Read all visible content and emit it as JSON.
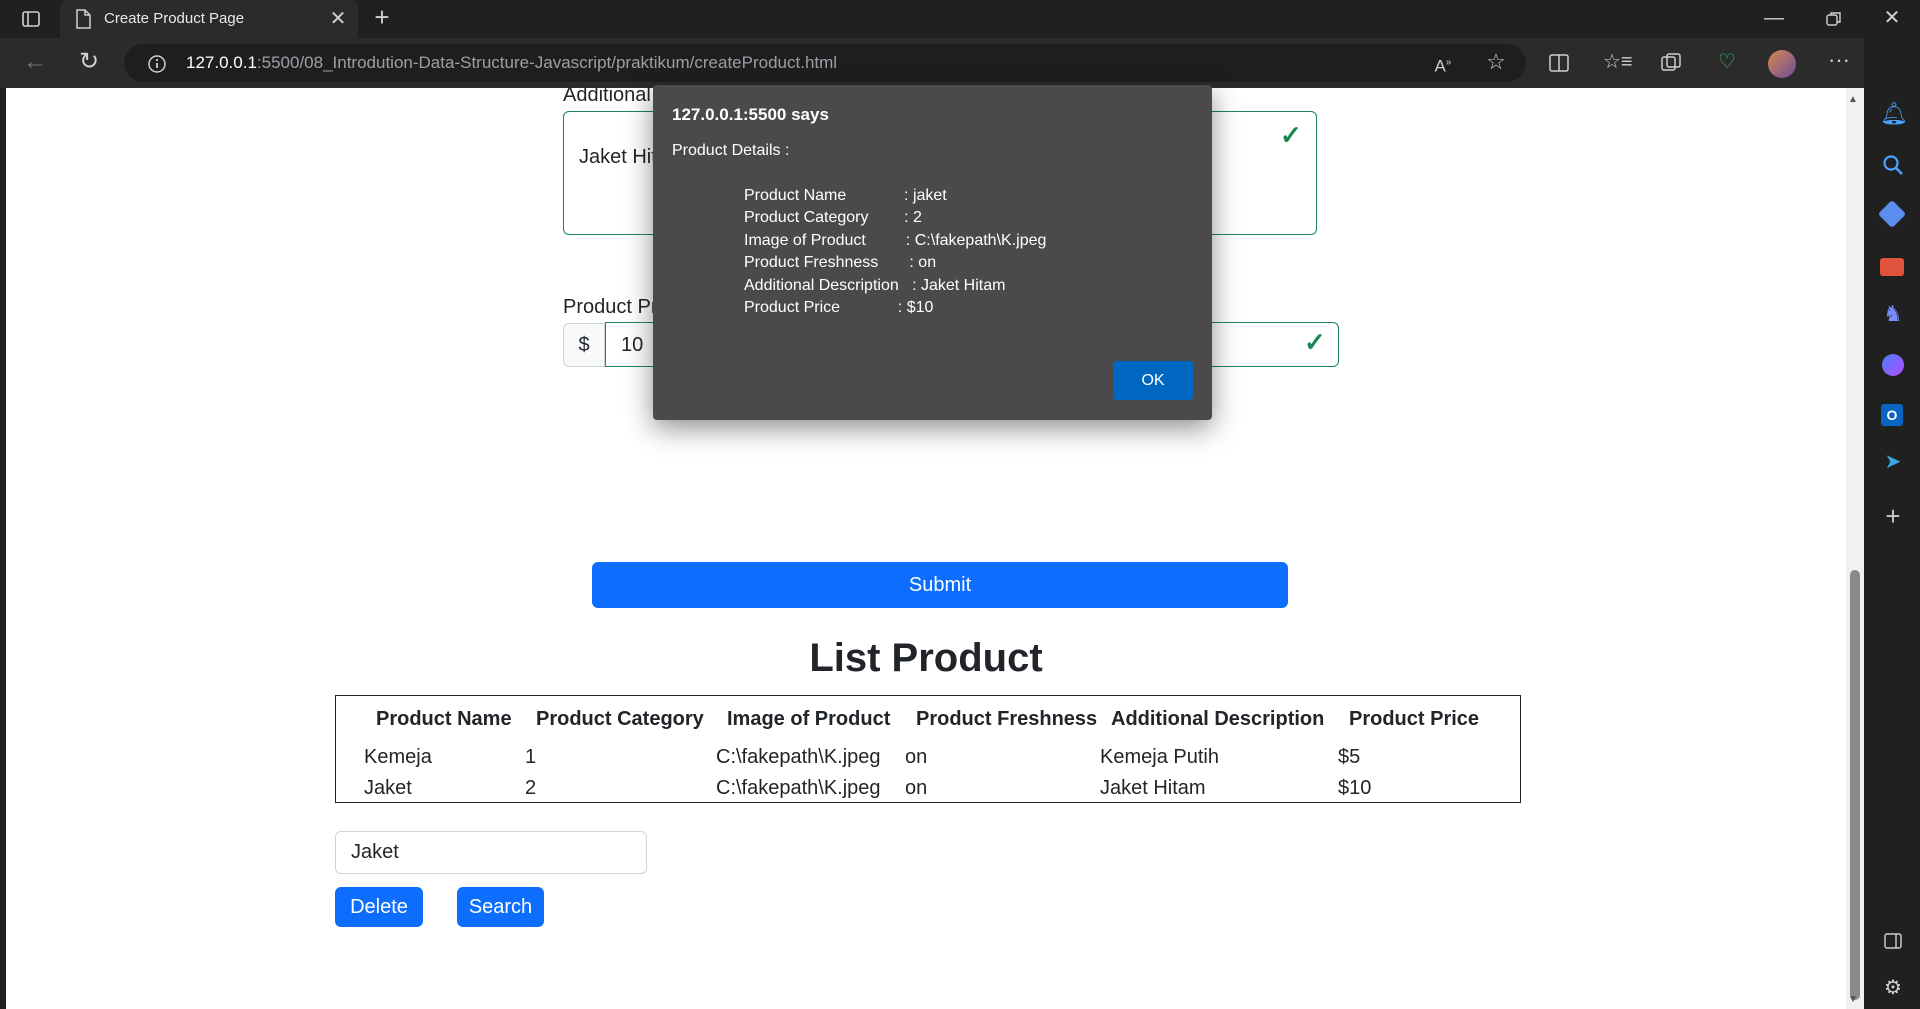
{
  "browser": {
    "tab_title": "Create Product Page",
    "url_host": "127.0.0.1",
    "url_rest": ":5500/08_Introdution-Data-Structure-Javascript/praktikum/createProduct.html"
  },
  "form": {
    "additional_label": "Additional",
    "additional_value": "Jaket Hit",
    "price_label": "Product Pr",
    "currency_symbol": "$",
    "price_value": "10",
    "submit_label": "Submit"
  },
  "list": {
    "title": "List Product",
    "headers": [
      "Product Name",
      "Product Category",
      "Image of Product",
      "Product Freshness",
      "Additional Description",
      "Product Price"
    ],
    "rows": [
      [
        "Kemeja",
        "1",
        "C:\\fakepath\\K.jpeg",
        "on",
        "Kemeja Putih",
        "$5"
      ],
      [
        "Jaket",
        "2",
        "C:\\fakepath\\K.jpeg",
        "on",
        "Jaket Hitam",
        "$10"
      ]
    ]
  },
  "search": {
    "value": "Jaket",
    "delete_label": "Delete",
    "search_label": "Search"
  },
  "dialog": {
    "title": "127.0.0.1:5500 says",
    "subtitle": "Product Details :",
    "lines": [
      "Product Name             : jaket",
      "Product Category        : 2",
      "Image of Product         : C:\\fakepath\\K.jpeg",
      "Product Freshness       : on",
      "Additional Description   : Jaket Hitam",
      "Product Price             : $10"
    ],
    "ok_label": "OK"
  }
}
